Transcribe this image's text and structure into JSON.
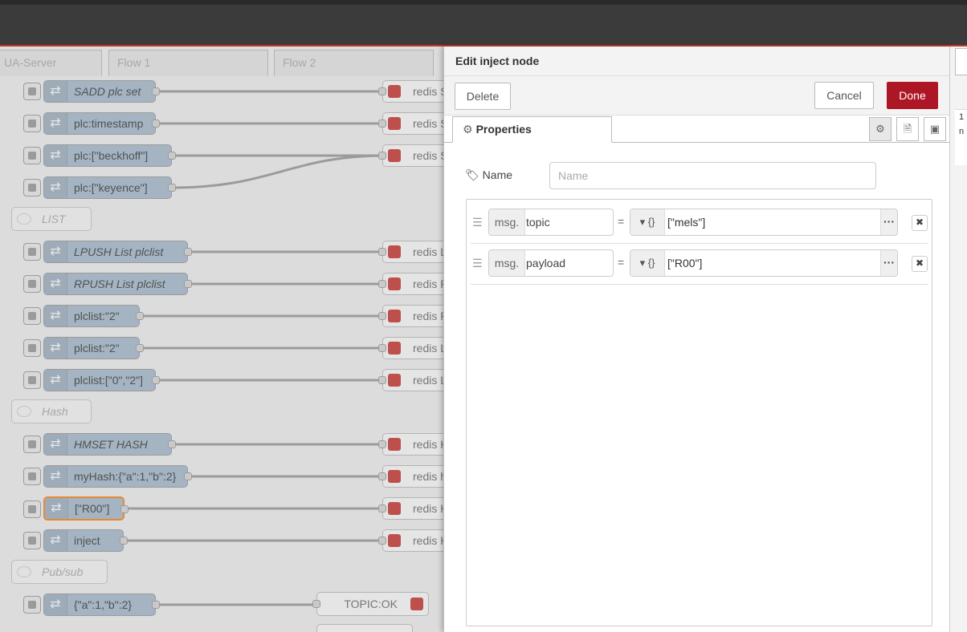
{
  "workspace_tabs": [
    "UA-Server",
    "Flow 1",
    "Flow 2"
  ],
  "flow": {
    "inject_nodes": [
      {
        "label": "SADD plc set",
        "italic": true
      },
      {
        "label": "plc:timestamp",
        "italic": false
      },
      {
        "label": "plc:[\"beckhoff\"]",
        "italic": false
      },
      {
        "label": "plc:[\"keyence\"]",
        "italic": false
      },
      {
        "label": "LPUSH List plclist",
        "italic": true
      },
      {
        "label": "RPUSH List plclist",
        "italic": true
      },
      {
        "label": "plclist:\"2\"",
        "italic": false
      },
      {
        "label": "plclist:\"2\"",
        "italic": false
      },
      {
        "label": "plclist:[\"0\",\"2\"]",
        "italic": false
      },
      {
        "label": "HMSET HASH",
        "italic": true
      },
      {
        "label": "myHash:{\"a\":1,\"b\":2}",
        "italic": false
      },
      {
        "label": "[\"R00\"]",
        "italic": false
      },
      {
        "label": "inject",
        "italic": false
      },
      {
        "label": "{\"a\":1,\"b\":2}",
        "italic": false
      }
    ],
    "comments": [
      "LIST",
      "Hash",
      "Pub/sub"
    ],
    "redis_nodes": [
      "redis S",
      "redis S",
      "redis S",
      "redis L",
      "redis R",
      "redis R",
      "redis L",
      "redis L",
      "redis H",
      "redis h",
      "redis H",
      "redis H"
    ],
    "topic_node": "TOPIC:OK"
  },
  "editor": {
    "title": "Edit inject node",
    "delete_label": "Delete",
    "cancel_label": "Cancel",
    "done_label": "Done",
    "tab_properties": "Properties",
    "name_label": "Name",
    "name_placeholder": "Name",
    "name_value": "",
    "rows": [
      {
        "prefix": "msg.",
        "property": "topic",
        "equals": "=",
        "type": "{}",
        "value": "[\"mels\"]"
      },
      {
        "prefix": "msg.",
        "property": "payload",
        "equals": "=",
        "type": "{}",
        "value": "[\"R00\"]"
      }
    ]
  },
  "sidebar": {
    "partial_text": "1\nn"
  },
  "colors": {
    "accent": "#ad1625",
    "inject_node": "#a6bbcf",
    "redis_icon": "#c8302b",
    "selected_outline": "#ff7f0e"
  }
}
